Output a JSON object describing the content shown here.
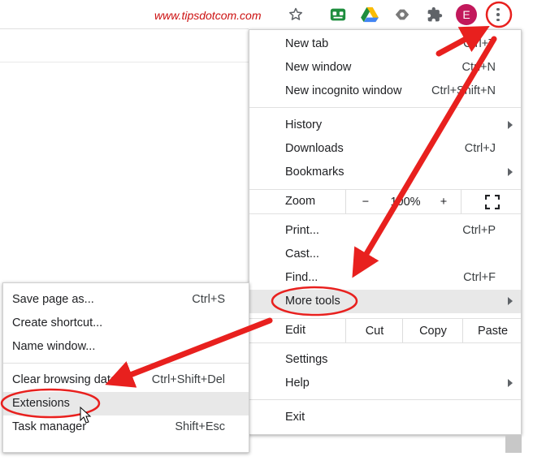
{
  "toolbar": {
    "watermark": "www.tipsdotcom.com",
    "icons": [
      "star-icon",
      "extension-green-icon",
      "google-drive-icon",
      "extension-gray-icon",
      "puzzle-icon"
    ],
    "avatar_letter": "E",
    "menu_icon": "three-dots-icon"
  },
  "menu": {
    "new_tab": "New tab",
    "new_tab_shortcut": "Ctrl+T",
    "new_window": "New window",
    "new_window_shortcut": "Ctrl+N",
    "new_incognito": "New incognito window",
    "new_incognito_shortcut": "Ctrl+Shift+N",
    "history": "History",
    "downloads": "Downloads",
    "downloads_shortcut": "Ctrl+J",
    "bookmarks": "Bookmarks",
    "zoom_label": "Zoom",
    "zoom_minus": "−",
    "zoom_value": "100%",
    "zoom_plus": "+",
    "print": "Print...",
    "print_shortcut": "Ctrl+P",
    "cast": "Cast...",
    "find": "Find...",
    "find_shortcut": "Ctrl+F",
    "more_tools": "More tools",
    "edit_label": "Edit",
    "cut": "Cut",
    "copy": "Copy",
    "paste": "Paste",
    "settings": "Settings",
    "help": "Help",
    "exit": "Exit"
  },
  "submenu": {
    "save_page": "Save page as...",
    "save_page_shortcut": "Ctrl+S",
    "create_shortcut": "Create shortcut...",
    "name_window": "Name window...",
    "clear_browsing": "Clear browsing data...",
    "clear_browsing_shortcut": "Ctrl+Shift+Del",
    "extensions": "Extensions",
    "task_manager": "Task manager",
    "task_manager_shortcut": "Shift+Esc"
  },
  "colors": {
    "annotation_red": "#e8201e",
    "highlight": "#e8e8e8",
    "avatar": "#c2185b"
  }
}
